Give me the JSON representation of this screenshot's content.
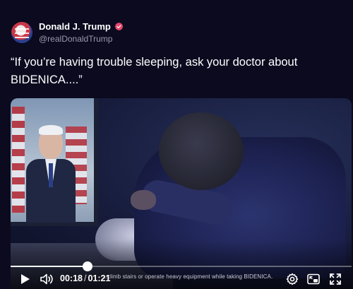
{
  "post": {
    "author": {
      "display_name": "Donald J. Trump",
      "handle": "@realDonaldTrump",
      "verified": true,
      "verified_color": "#e8476a"
    },
    "text": "“If you’re having trouble sleeping, ask your doctor about BIDENICA....”"
  },
  "video": {
    "caption": "...climb stairs or operate heavy equipment while taking BIDENICA.",
    "current_time": "00:18",
    "separator": "/",
    "duration": "01:21",
    "progress_fraction": 0.226,
    "icons": {
      "play": "play-icon",
      "volume": "volume-icon",
      "settings": "settings-icon",
      "pip": "picture-in-picture-icon",
      "fullscreen": "fullscreen-icon"
    }
  }
}
